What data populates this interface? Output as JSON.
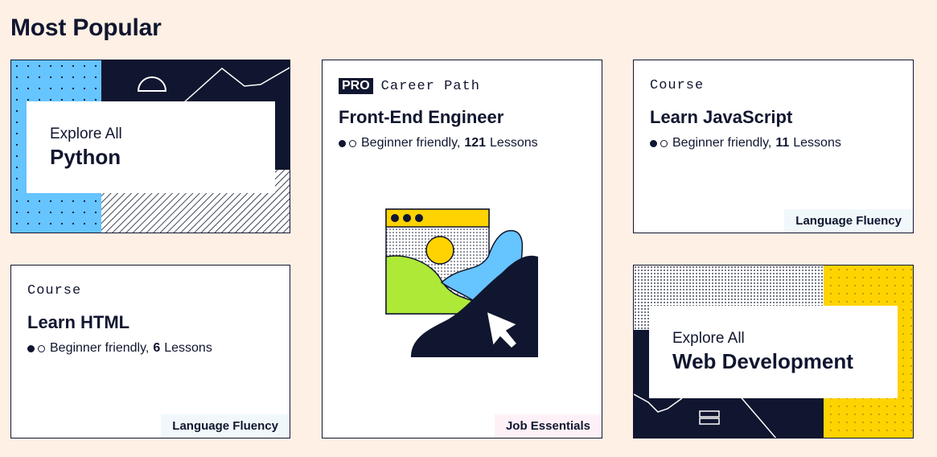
{
  "page": {
    "title": "Most Popular"
  },
  "cards": {
    "python": {
      "kicker": "Explore All",
      "title": "Python"
    },
    "frontend": {
      "pro_label": "PRO",
      "kind": "Career Path",
      "title": "Front-End Engineer",
      "difficulty": "Beginner friendly,",
      "lesson_count": "121",
      "lessons_label": "Lessons",
      "tag": "Job Essentials"
    },
    "javascript": {
      "kind": "Course",
      "title": "Learn JavaScript",
      "difficulty": "Beginner friendly,",
      "lesson_count": "11",
      "lessons_label": "Lessons",
      "tag": "Language Fluency"
    },
    "html": {
      "kind": "Course",
      "title": "Learn HTML",
      "difficulty": "Beginner friendly,",
      "lesson_count": "6",
      "lessons_label": "Lessons",
      "tag": "Language Fluency"
    },
    "webdev": {
      "kicker": "Explore All",
      "title": "Web Development"
    }
  },
  "colors": {
    "background": "#fff0e5",
    "navy": "#10162f",
    "blue": "#66c4ff",
    "yellow": "#ffd300",
    "green": "#aee938"
  },
  "icons": {
    "difficulty": [
      "filled-dot-icon",
      "empty-dot-icon"
    ],
    "illustration": "browser-window-cursor-illustration"
  }
}
